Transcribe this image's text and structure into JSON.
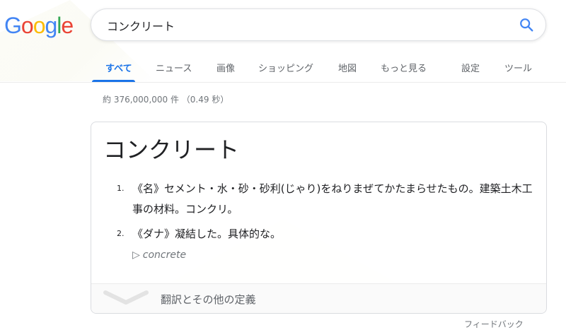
{
  "logo": {
    "letters": [
      "G",
      "o",
      "o",
      "g",
      "l",
      "e"
    ],
    "colors": [
      "#4285f4",
      "#ea4335",
      "#fbbc05",
      "#4285f4",
      "#34a853",
      "#ea4335"
    ]
  },
  "search": {
    "query": "コンクリート",
    "icon": "search-icon",
    "accent": "#4285f4"
  },
  "tabs": [
    {
      "label": "すべて",
      "active": true
    },
    {
      "label": "ニュース"
    },
    {
      "label": "画像"
    },
    {
      "label": "ショッピング"
    },
    {
      "label": "地図"
    },
    {
      "label": "もっと見る"
    },
    {
      "label": "設定"
    },
    {
      "label": "ツール"
    }
  ],
  "result_stats": "約 376,000,000 件 （0.49 秒）",
  "dictionary": {
    "headword": "コンクリート",
    "definitions": [
      {
        "num": "1.",
        "text": "《名》セメント・水・砂・砂利(じゃり)をねりまぜてかたまらせたもの。建築土木工事の材料。コンクリ。"
      },
      {
        "num": "2.",
        "text": "《ダナ》凝結した。具体的な。"
      }
    ],
    "synonym": "concrete",
    "more_label": "翻訳とその他の定義"
  },
  "feedback_label": "フィードバック"
}
